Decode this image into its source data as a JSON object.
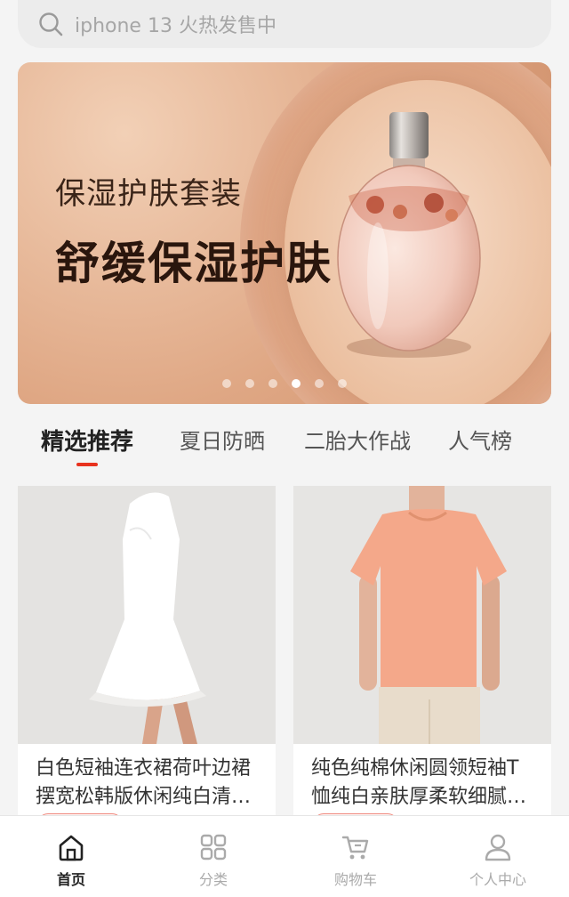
{
  "search": {
    "placeholder": "iphone 13 火热发售中",
    "icon": "search-icon"
  },
  "banner": {
    "subtitle": "保湿护肤套装",
    "title": "舒缓保湿护肤",
    "dots_count": 6,
    "active_dot": 4
  },
  "tabs": [
    {
      "label": "精选推荐",
      "active": true
    },
    {
      "label": "夏日防晒",
      "active": false
    },
    {
      "label": "二胎大作战",
      "active": false
    },
    {
      "label": "人气榜",
      "active": false
    }
  ],
  "products": [
    {
      "title": "白色短袖连衣裙荷叶边裙摆宽松韩版休闲纯白清…"
    },
    {
      "title": "纯色纯棉休闲圆领短袖T恤纯白亲肤厚柔软细腻…"
    }
  ],
  "bottom_nav": [
    {
      "label": "首页",
      "icon": "home-icon",
      "active": true
    },
    {
      "label": "分类",
      "icon": "grid-icon",
      "active": false
    },
    {
      "label": "购物车",
      "icon": "cart-icon",
      "active": false
    },
    {
      "label": "个人中心",
      "icon": "user-icon",
      "active": false
    }
  ],
  "colors": {
    "accent": "#e8321e",
    "background": "#f4f4f4"
  }
}
